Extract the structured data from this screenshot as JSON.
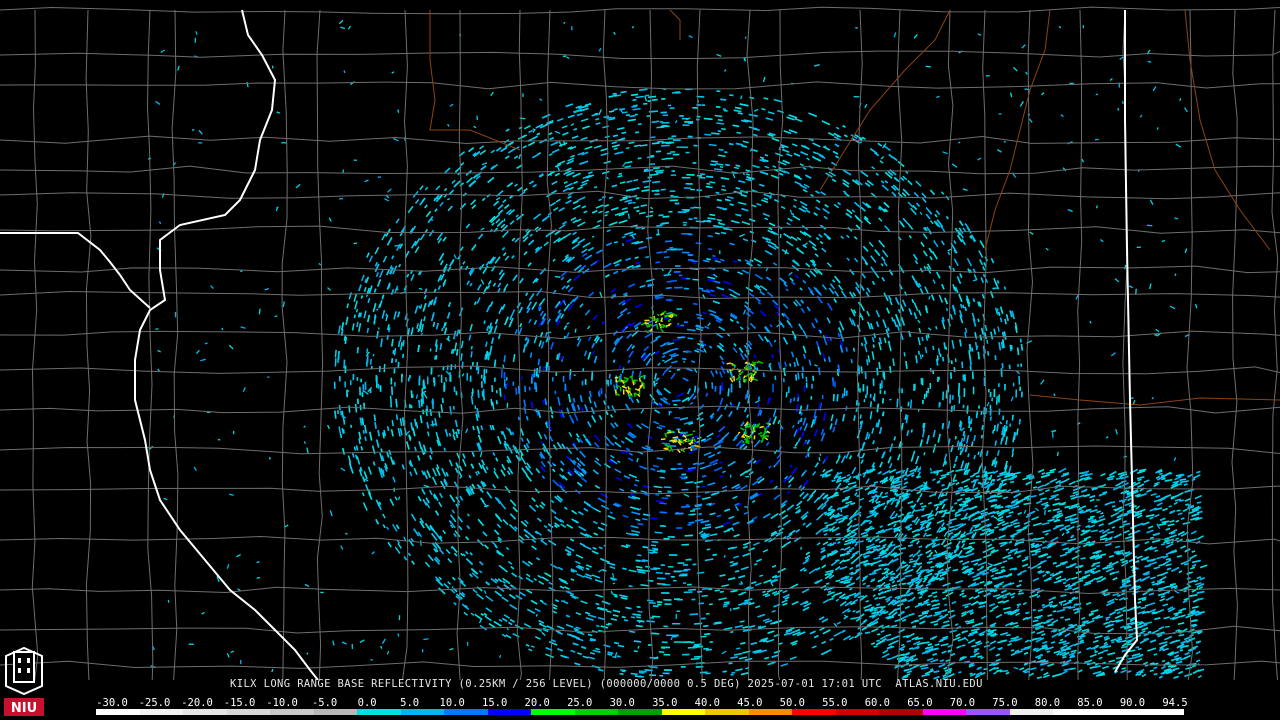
{
  "caption": "KILX LONG RANGE BASE REFLECTIVITY (0.25KM / 256 LEVEL) (000000/0000 0.5 DEG) 2025-07-01 17:01 UTC  ATLAS.NIU.EDU",
  "logo": {
    "text": "NIU",
    "color": "#c8102e"
  },
  "scale": {
    "labels": [
      "-30.0",
      "-25.0",
      "-20.0",
      "-15.0",
      "-10.0",
      "-5.0",
      "0.0",
      "5.0",
      "10.0",
      "15.0",
      "20.0",
      "25.0",
      "30.0",
      "35.0",
      "40.0",
      "45.0",
      "50.0",
      "55.0",
      "60.0",
      "65.0",
      "70.0",
      "75.0",
      "80.0",
      "85.0",
      "90.0",
      "94.5"
    ],
    "colors": [
      "#ffffff",
      "#f2f2f2",
      "#e5e5e5",
      "#d8d8d8",
      "#c8c8c8",
      "#b8b8b8",
      "#00e0e0",
      "#00b4f0",
      "#0078ff",
      "#0000ff",
      "#00ff00",
      "#00d000",
      "#00a000",
      "#ffff00",
      "#f0c800",
      "#ff8c00",
      "#ff0000",
      "#d40000",
      "#b00000",
      "#ff00ff",
      "#9a55ff",
      "#f0f0f0",
      "#ffffff",
      "#ffffff",
      "#ffffff"
    ]
  },
  "map": {
    "background": "#000000",
    "county_color": "#6e6e6e",
    "state_color": "#ffffff",
    "river_color": "#8b4513",
    "radar_site_label": "KILX"
  }
}
